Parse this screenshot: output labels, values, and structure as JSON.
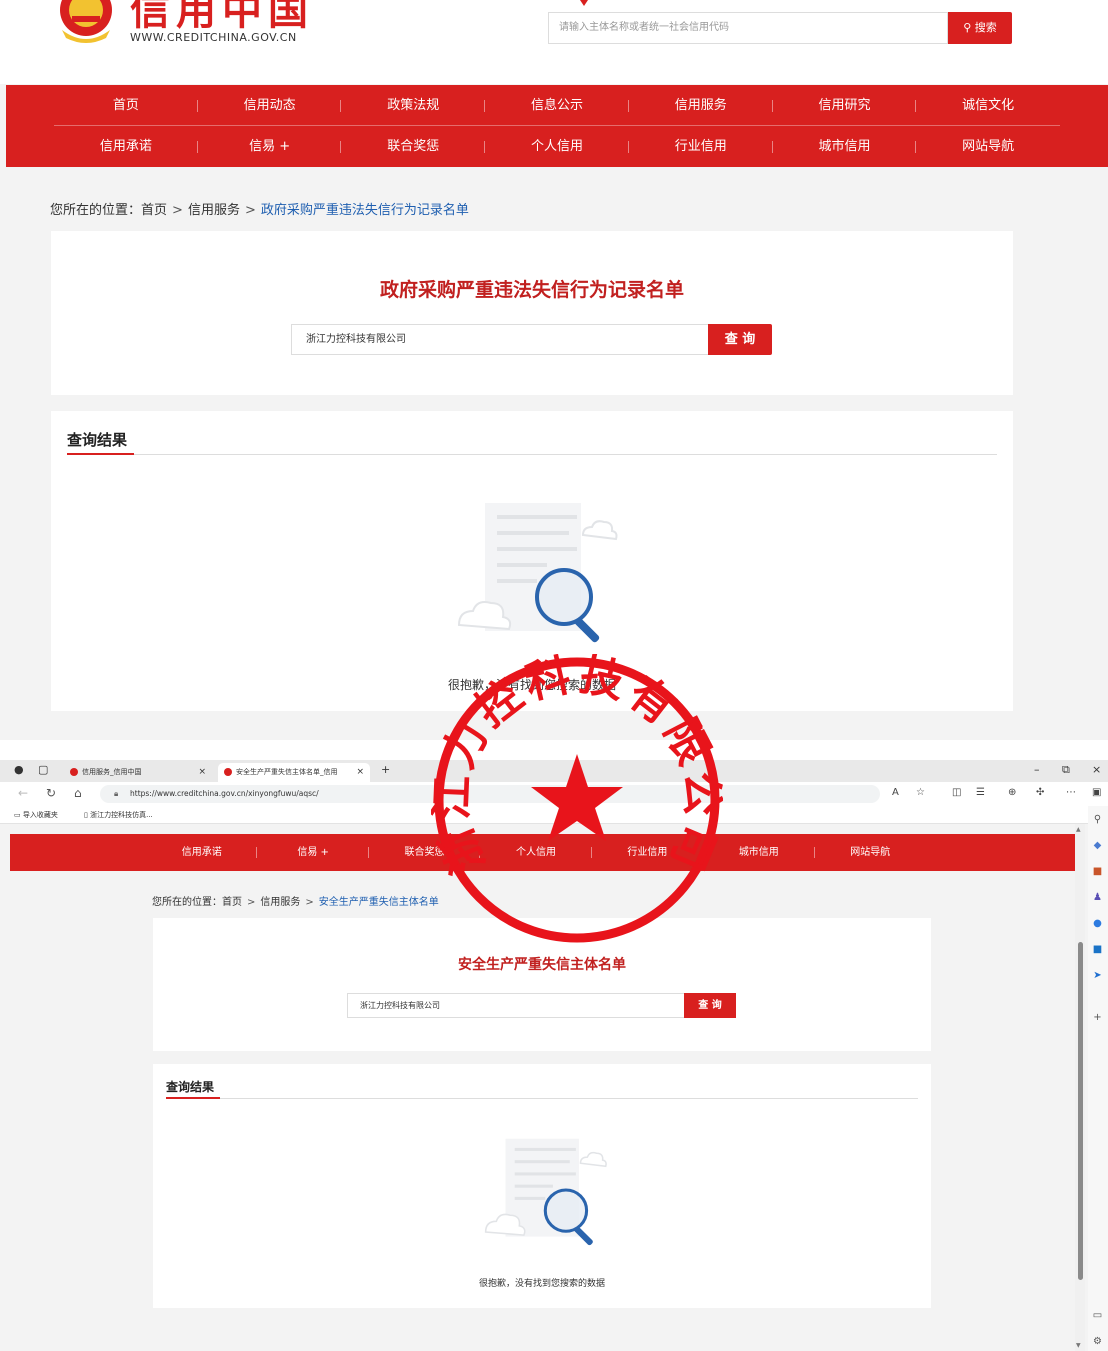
{
  "top": {
    "site": {
      "brand": "信用中国",
      "url": "WWW.CREDITCHINA.GOV.CN",
      "search_placeholder": "请输入主体名称或者统一社会信用代码",
      "search_button": "搜索"
    },
    "nav": {
      "row1": [
        "首页",
        "信用动态",
        "政策法规",
        "信息公示",
        "信用服务",
        "信用研究",
        "诚信文化"
      ],
      "row2": [
        "信用承诺",
        "信易 +",
        "联合奖惩",
        "个人信用",
        "行业信用",
        "城市信用",
        "网站导航"
      ]
    },
    "breadcrumb": {
      "prefix": "您所在的位置：",
      "home": "首页",
      "sep": ">",
      "section": "信用服务",
      "current": "政府采购严重违法失信行为记录名单"
    },
    "query": {
      "title": "政府采购严重违法失信行为记录名单",
      "input_value": "浙江力控科技有限公司",
      "button": "查 询"
    },
    "results": {
      "title": "查询结果",
      "empty_text": "很抱歉，没有找到您搜索的数据"
    }
  },
  "browser": {
    "tabs": [
      {
        "label": "信用服务_信用中国",
        "close": "×"
      },
      {
        "label": "安全生产严重失信主体名单_信用",
        "close": "×"
      }
    ],
    "new_tab": "+",
    "window_controls": [
      "–",
      "⧉",
      "×"
    ],
    "url": "https://www.creditchina.gov.cn/xinyongfuwu/aqsc/",
    "favorites": [
      "导入收藏夹",
      "浙江力控科技仿真..."
    ]
  },
  "bottom": {
    "nav": [
      "信用承诺",
      "信易 +",
      "联合奖惩",
      "个人信用",
      "行业信用",
      "城市信用",
      "网站导航"
    ],
    "breadcrumb": {
      "prefix": "您所在的位置：",
      "home": "首页",
      "sep": ">",
      "section": "信用服务",
      "current": "安全生产严重失信主体名单"
    },
    "query": {
      "title": "安全生产严重失信主体名单",
      "input_value": "浙江力控科技有限公司",
      "button": "查 询"
    },
    "results": {
      "title": "查询结果",
      "empty_text": "很抱歉，没有找到您搜索的数据"
    }
  },
  "seal": {
    "text": "浙江力控科技有限公司",
    "color": "#e8141b"
  },
  "colors": {
    "brand_red": "#d8201f",
    "title_red": "#c1201f",
    "link_blue": "#1f5fb0"
  }
}
